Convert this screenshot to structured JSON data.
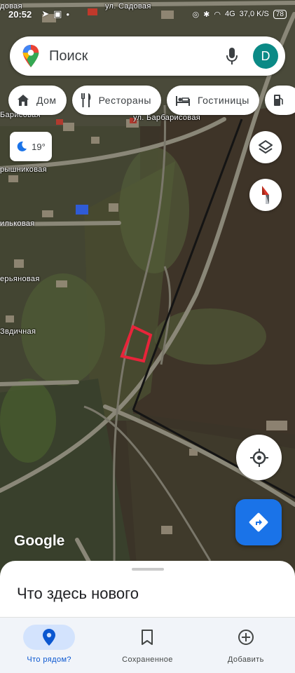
{
  "status_bar": {
    "time": "20:52",
    "network": "4G",
    "speed": "37,0 K/S",
    "battery": "78"
  },
  "search": {
    "placeholder": "Поиск",
    "avatar_letter": "D"
  },
  "chips": [
    {
      "label": "Дом",
      "icon": "home-icon"
    },
    {
      "label": "Рестораны",
      "icon": "restaurant-icon"
    },
    {
      "label": "Гостиницы",
      "icon": "hotel-icon"
    },
    {
      "label": "",
      "icon": "gas-station-icon"
    }
  ],
  "weather": {
    "temperature": "19°",
    "icon": "moon-icon"
  },
  "map": {
    "streets": [
      {
        "label": "ул. Садовая"
      },
      {
        "label": "довая"
      },
      {
        "label": "ул. Барбарисовая"
      },
      {
        "label": "Барисовая"
      },
      {
        "label": "рышниковая"
      },
      {
        "label": "ильковая"
      },
      {
        "label": "ерьяновая"
      },
      {
        "label": "Звдичная"
      }
    ],
    "highlight_color": "#e8243a",
    "attribution": "Google"
  },
  "sheet": {
    "title": "Что здесь нового"
  },
  "bottom_nav": {
    "items": [
      {
        "label": "Что рядом?",
        "icon": "location-pin-icon",
        "active": true
      },
      {
        "label": "Сохраненное",
        "icon": "bookmark-icon",
        "active": false
      },
      {
        "label": "Добавить",
        "icon": "add-circle-icon",
        "active": false
      }
    ]
  },
  "colors": {
    "accent": "#1a73e8",
    "avatar_bg": "#0b8a86",
    "nav_active": "#0b57d0"
  }
}
